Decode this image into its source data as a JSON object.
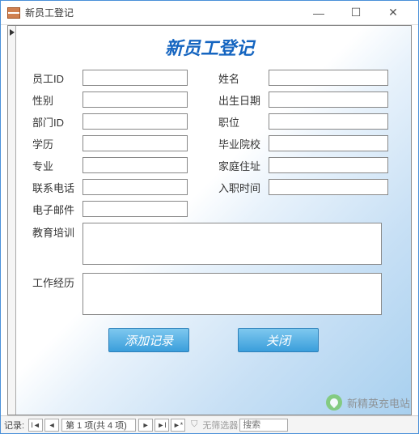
{
  "window": {
    "title": "新员工登记"
  },
  "form": {
    "title": "新员工登记",
    "fields": {
      "emp_id": {
        "label": "员工ID",
        "value": ""
      },
      "name": {
        "label": "姓名",
        "value": ""
      },
      "gender": {
        "label": "性别",
        "value": ""
      },
      "birth": {
        "label": "出生日期",
        "value": ""
      },
      "dept_id": {
        "label": "部门ID",
        "value": ""
      },
      "job": {
        "label": "职位",
        "value": ""
      },
      "edu": {
        "label": "学历",
        "value": ""
      },
      "school": {
        "label": "毕业院校",
        "value": ""
      },
      "major": {
        "label": "专业",
        "value": ""
      },
      "addr": {
        "label": "家庭住址",
        "value": ""
      },
      "phone": {
        "label": "联系电话",
        "value": ""
      },
      "hire": {
        "label": "入职时间",
        "value": ""
      },
      "email": {
        "label": "电子邮件",
        "value": ""
      },
      "training": {
        "label": "教育培训",
        "value": ""
      },
      "work_exp": {
        "label": "工作经历",
        "value": ""
      }
    },
    "buttons": {
      "add": "添加记录",
      "close": "关闭"
    }
  },
  "statusbar": {
    "records_label": "记录:",
    "position": "第 1 项(共 4 项)",
    "filter_text": "无筛选器",
    "search": "搜索"
  },
  "watermark": "新精英充电站"
}
